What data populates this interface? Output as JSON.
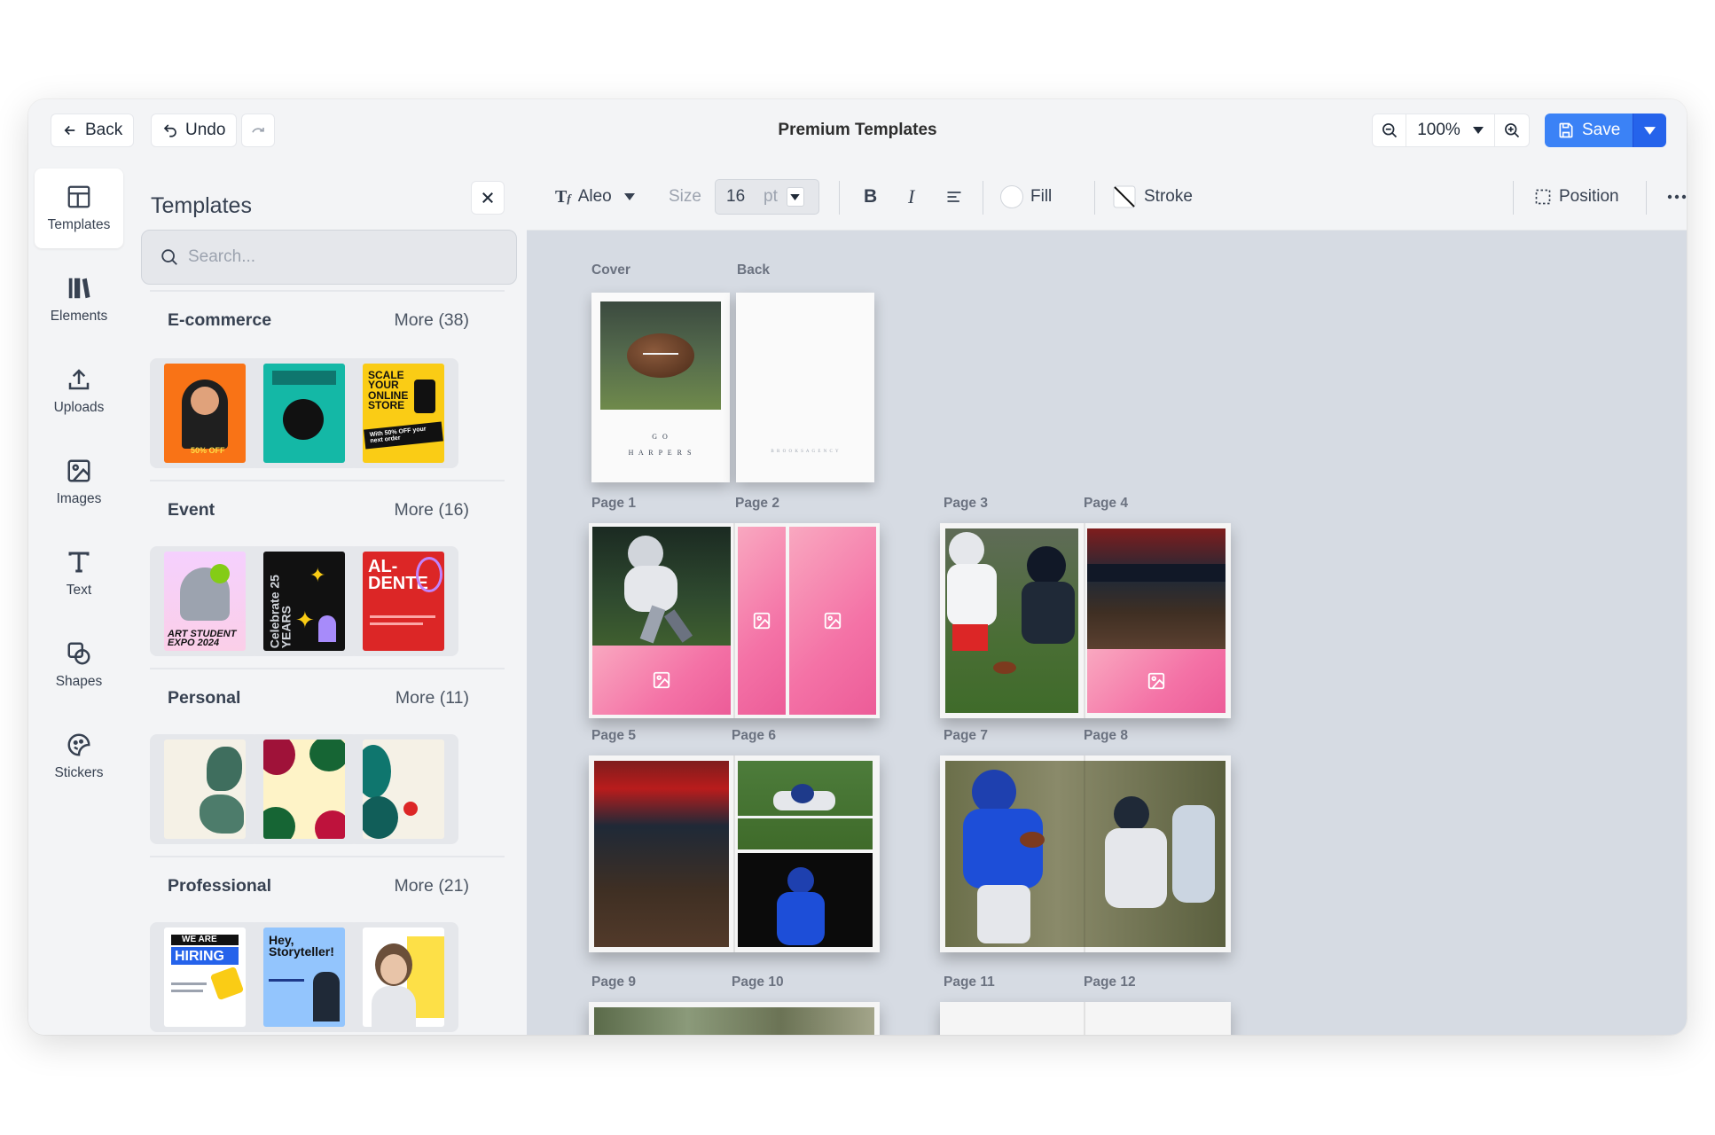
{
  "topbar": {
    "back_label": "Back",
    "undo_label": "Undo",
    "title": "Premium Templates",
    "zoom_value": "100%",
    "save_label": "Save"
  },
  "rail": {
    "items": [
      {
        "label": "Templates",
        "icon": "layout-icon",
        "active": true
      },
      {
        "label": "Elements",
        "icon": "elements-icon"
      },
      {
        "label": "Uploads",
        "icon": "upload-icon"
      },
      {
        "label": "Images",
        "icon": "image-icon"
      },
      {
        "label": "Text",
        "icon": "text-icon"
      },
      {
        "label": "Shapes",
        "icon": "shapes-icon"
      },
      {
        "label": "Stickers",
        "icon": "sticker-icon"
      }
    ]
  },
  "panel": {
    "title": "Templates",
    "search_placeholder": "Search...",
    "categories": [
      {
        "name": "E-commerce",
        "more": "More (38)"
      },
      {
        "name": "Event",
        "more": "More (16)"
      },
      {
        "name": "Personal",
        "more": "More (11)"
      },
      {
        "name": "Professional",
        "more": "More (21)"
      }
    ],
    "thumb_text": {
      "scale": "SCALE YOUR ONLINE STORE",
      "scale_sub": "With 50% OFF your next order",
      "art": "ART STUDENT EXPO 2024",
      "celebrate": "Celebrate 25 YEARS",
      "aldente": "AL- DENTE",
      "hiring_we": "WE ARE",
      "hiring": "HIRING",
      "story": "Hey, Storyteller!",
      "fifty": "50% OFF"
    }
  },
  "format": {
    "font_name": "Aleo",
    "size_label": "Size",
    "size_value": "16",
    "size_unit": "pt",
    "fill_label": "Fill",
    "stroke_label": "Stroke",
    "position_label": "Position"
  },
  "canvas": {
    "labels": {
      "cover": "Cover",
      "back": "Back",
      "p1": "Page 1",
      "p2": "Page 2",
      "p3": "Page 3",
      "p4": "Page 4",
      "p5": "Page 5",
      "p6": "Page 6",
      "p7": "Page 7",
      "p8": "Page 8",
      "p9": "Page 9",
      "p10": "Page 10",
      "p11": "Page 11",
      "p12": "Page 12"
    },
    "cover_text_1": "G O",
    "cover_text_2": "H A R P E R S",
    "back_text": "B R O O K S   A G E N C Y"
  },
  "colors": {
    "accent": "#3b82f6",
    "placeholder_pink": "#f472a6"
  }
}
